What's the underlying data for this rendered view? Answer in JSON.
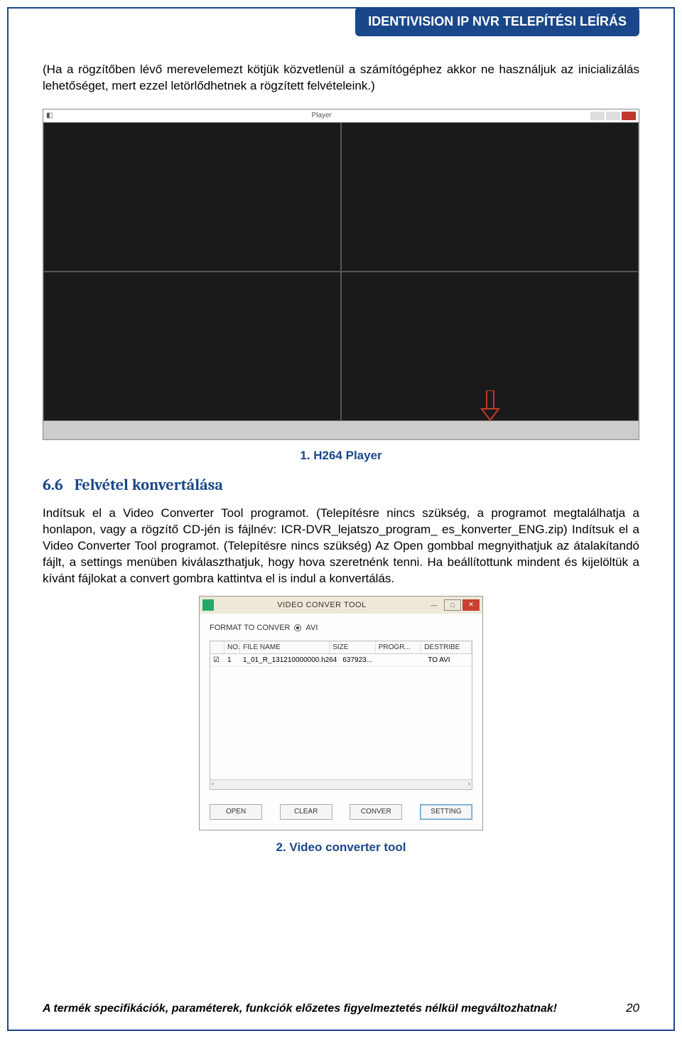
{
  "header": {
    "title": "IDENTIVISION IP NVR TELEPÍTÉSI LEÍRÁS"
  },
  "intro": "(Ha a rögzítőben lévő merevelemezt kötjük közvetlenül a számítógéphez akkor ne használjuk az inicializálás lehetőséget, mert ezzel letörlődhetnek a rögzített felvételeink.)",
  "player": {
    "titlebar": "Player"
  },
  "captions": {
    "fig1_num": "1.",
    "fig1_text": "H264 Player",
    "fig2_num": "2.",
    "fig2_text": "Video converter tool"
  },
  "section": {
    "number": "6.6",
    "title": "Felvétel konvertálása"
  },
  "body": "Indítsuk el a Video Converter Tool programot. (Telepítésre nincs szükség, a programot megtalálhatja a honlapon, vagy a rögzítő CD-jén is fájlnév: ICR-DVR_lejatszo_program_ es_konverter_ENG.zip) Indítsuk el a Video Converter Tool programot. (Telepítésre nincs szükség) Az Open gombbal megnyithatjuk az átalakítandó fájlt, a settings menüben kiválaszthatjuk, hogy hova szeretnénk tenni. Ha beállítottunk mindent és kijelöltük a kívánt fájlokat a convert gombra kattintva el is indul a konvertálás.",
  "vct": {
    "title": "VIDEO CONVER TOOL",
    "format_label": "FORMAT TO CONVER",
    "format_option": "AVI",
    "columns": [
      "NO.",
      "FILE NAME",
      "SIZE",
      "PROGR...",
      "DESTRIBE"
    ],
    "rows": [
      {
        "no": "1",
        "file": "1_01_R_131210000000.h264",
        "size": "637923...",
        "progress": "",
        "destribe": "TO AVI"
      }
    ],
    "buttons": [
      "OPEN",
      "CLEAR",
      "CONVER",
      "SETTING"
    ]
  },
  "footer": {
    "text": "A termék specifikációk, paraméterek, funkciók előzetes figyelmeztetés nélkül megváltozhatnak!",
    "page": "20"
  }
}
